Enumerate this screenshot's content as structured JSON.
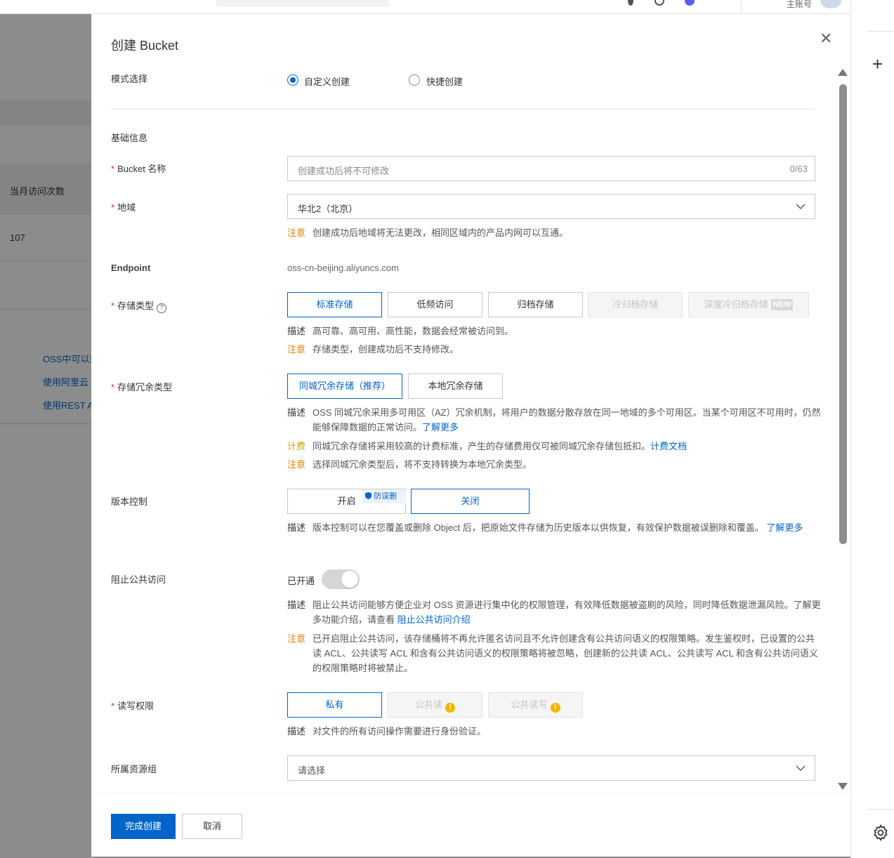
{
  "background": {
    "account_label": "主账号",
    "table_header": "当月访问次数",
    "table_value": "107",
    "links": [
      "OSS中可以重",
      "使用阿里云",
      "使用REST A"
    ]
  },
  "drawer": {
    "title": "创建 Bucket",
    "mode": {
      "label": "模式选择",
      "options": [
        "自定义创建",
        "快捷创建"
      ],
      "selected": "自定义创建"
    },
    "basic_section": "基础信息",
    "bucket_name": {
      "label": "Bucket 名称",
      "placeholder": "创建成功后将不可修改",
      "counter": "0/63"
    },
    "region": {
      "label": "地域",
      "value": "华北2（北京）",
      "note_tag": "注意",
      "note_text": "创建成功后地域将无法更改，相同区域内的产品内网可以互通。"
    },
    "endpoint": {
      "label": "Endpoint",
      "value": "oss-cn-beijing.aliyuncs.com"
    },
    "storage_class": {
      "label": "存储类型",
      "options": [
        "标准存储",
        "低频访问",
        "归档存储",
        "冷归档存储",
        "深度冷归档存储"
      ],
      "new_badge": "NEW",
      "desc_tag": "描述",
      "desc_text": "高可靠、高可用、高性能，数据会经常被访问到。",
      "warn_tag": "注意",
      "warn_text": "存储类型，创建成功后不支持修改。"
    },
    "redundancy": {
      "label": "存储冗余类型",
      "options": [
        "同城冗余存储（推荐）",
        "本地冗余存储"
      ],
      "desc_tag": "描述",
      "desc_text": "OSS 同城冗余采用多可用区（AZ）冗余机制，将用户的数据分散存放在同一地域的多个可用区。当某个可用区不可用时，仍然能够保障数据的正常访问。",
      "desc_link": "了解更多",
      "fee_tag": "计费",
      "fee_text": "同城冗余存储将采用较高的计费标准，产生的存储费用仅可被同城冗余存储包抵扣。",
      "fee_link": "计费文档",
      "warn_tag": "注意",
      "warn_text": "选择同城冗余类型后，将不支持转换为本地冗余类型。"
    },
    "versioning": {
      "label": "版本控制",
      "on_label": "开启",
      "badge": "防误删",
      "off_label": "关闭",
      "desc_tag": "描述",
      "desc_text": "版本控制可以在您覆盖或删除 Object 后，把原始文件存储为历史版本以供恢复，有效保护数据被误删除和覆盖。",
      "desc_link": "了解更多"
    },
    "block_public": {
      "label": "阻止公共访问",
      "status": "已开通",
      "desc_tag": "描述",
      "desc_text": "阻止公共访问能够方便企业对 OSS 资源进行集中化的权限管理，有效降低数据被盗刷的风险，同时降低数据泄漏风险。了解更多功能介绍，请查看",
      "desc_link": "阻止公共访问介绍",
      "warn_tag": "注意",
      "warn_text": "已开启阻止公共访问，该存储桶将不再允许匿名访问且不允许创建含有公共访问语义的权限策略。发生鉴权时，已设置的公共读 ACL、公共读写 ACL 和含有公共访问语义的权限策略将被忽略，创建新的公共读 ACL、公共读写 ACL 和含有公共访问语义的权限策略时将被禁止。"
    },
    "acl": {
      "label": "读写权限",
      "options": [
        "私有",
        "公共读",
        "公共读写"
      ],
      "desc_tag": "描述",
      "desc_text": "对文件的所有访问操作需要进行身份验证。"
    },
    "resource_group": {
      "label": "所属资源组",
      "placeholder": "请选择"
    },
    "footer": {
      "submit": "完成创建",
      "cancel": "取消"
    }
  },
  "colors": {
    "primary": "#0064c8",
    "warn": "#e08000",
    "fee": "#c9a100",
    "required": "#d93026"
  }
}
